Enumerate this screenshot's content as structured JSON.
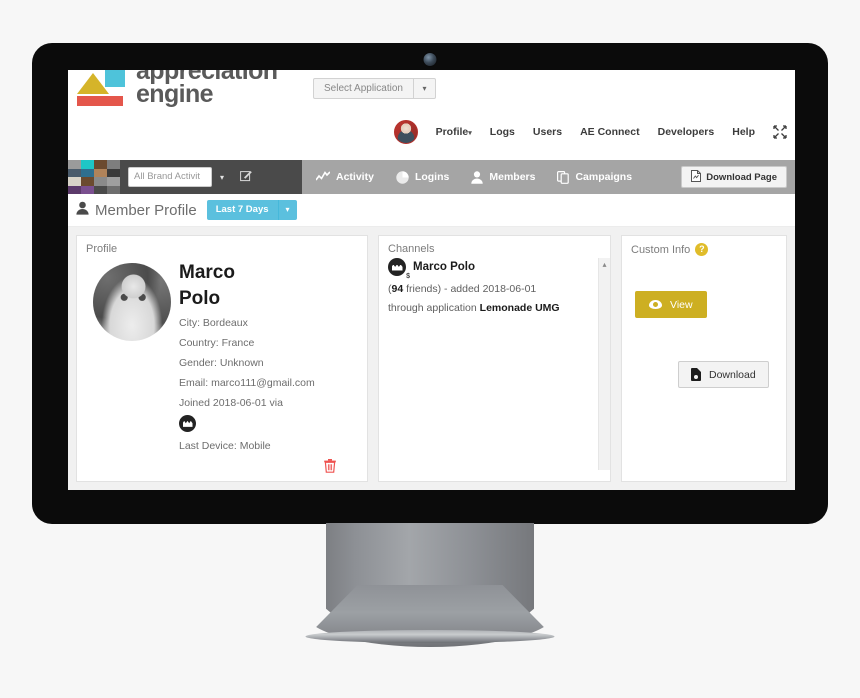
{
  "app": {
    "logo_line1": "appreciation",
    "logo_line2": "engine",
    "select_application": "Select Application",
    "select_caret": "▾"
  },
  "top_nav": {
    "avatar_name": "user-avatar",
    "items": [
      {
        "label": "Profile",
        "caret": "▾"
      },
      {
        "label": "Logs",
        "caret": ""
      },
      {
        "label": "Users",
        "caret": ""
      },
      {
        "label": "AE Connect",
        "caret": ""
      },
      {
        "label": "Developers",
        "caret": ""
      },
      {
        "label": "Help",
        "caret": ""
      }
    ],
    "expand_icon": "⤡"
  },
  "toolbar": {
    "brand_select_value": "All Brand Activit",
    "brand_caret": "▾",
    "edit_icon": "✎",
    "items": [
      {
        "label": "Activity",
        "icon": "line-chart-icon"
      },
      {
        "label": "Logins",
        "icon": "pie-chart-icon"
      },
      {
        "label": "Members",
        "icon": "person-icon"
      },
      {
        "label": "Campaigns",
        "icon": "copy-icon"
      }
    ],
    "download_page_label": "Download Page"
  },
  "page": {
    "title": "Member Profile",
    "date_range_label": "Last 7 Days",
    "date_range_caret": "▾"
  },
  "profile_card": {
    "title": "Profile",
    "first_name": "Marco",
    "last_name": "Polo",
    "city": "City: Bordeaux",
    "country": "Country: France",
    "gender": "Gender: Unknown",
    "email": "Email: marco111@gmail.com",
    "joined": "Joined 2018-06-01 via",
    "last_device": "Last Device: Mobile",
    "delete_icon": "🗑"
  },
  "channels_card": {
    "title": "Channels",
    "channel_name": "Marco Polo",
    "badge": "$",
    "friends_count": "94",
    "friends_text_pre": "(",
    "friends_text_post": " friends) - added 2018-06-01",
    "application_pre": "through application ",
    "application_name": "Lemonade UMG",
    "scroll_arrow": "▴"
  },
  "custom_info_card": {
    "title": "Custom Info",
    "help_icon": "?",
    "view_label": "View",
    "download_label": "Download"
  },
  "colors": {
    "accent_blue": "#5bc0de",
    "accent_yellow": "#cdaf22",
    "help_yellow": "#e0bc2a",
    "delete_red": "#ef5350",
    "toolbar_gray": "#a5a5a5",
    "toolbar_dark": "#4a4a4a",
    "logo_yellow": "#d5b429",
    "logo_cyan": "#4ec3da",
    "logo_red": "#e4564b"
  }
}
